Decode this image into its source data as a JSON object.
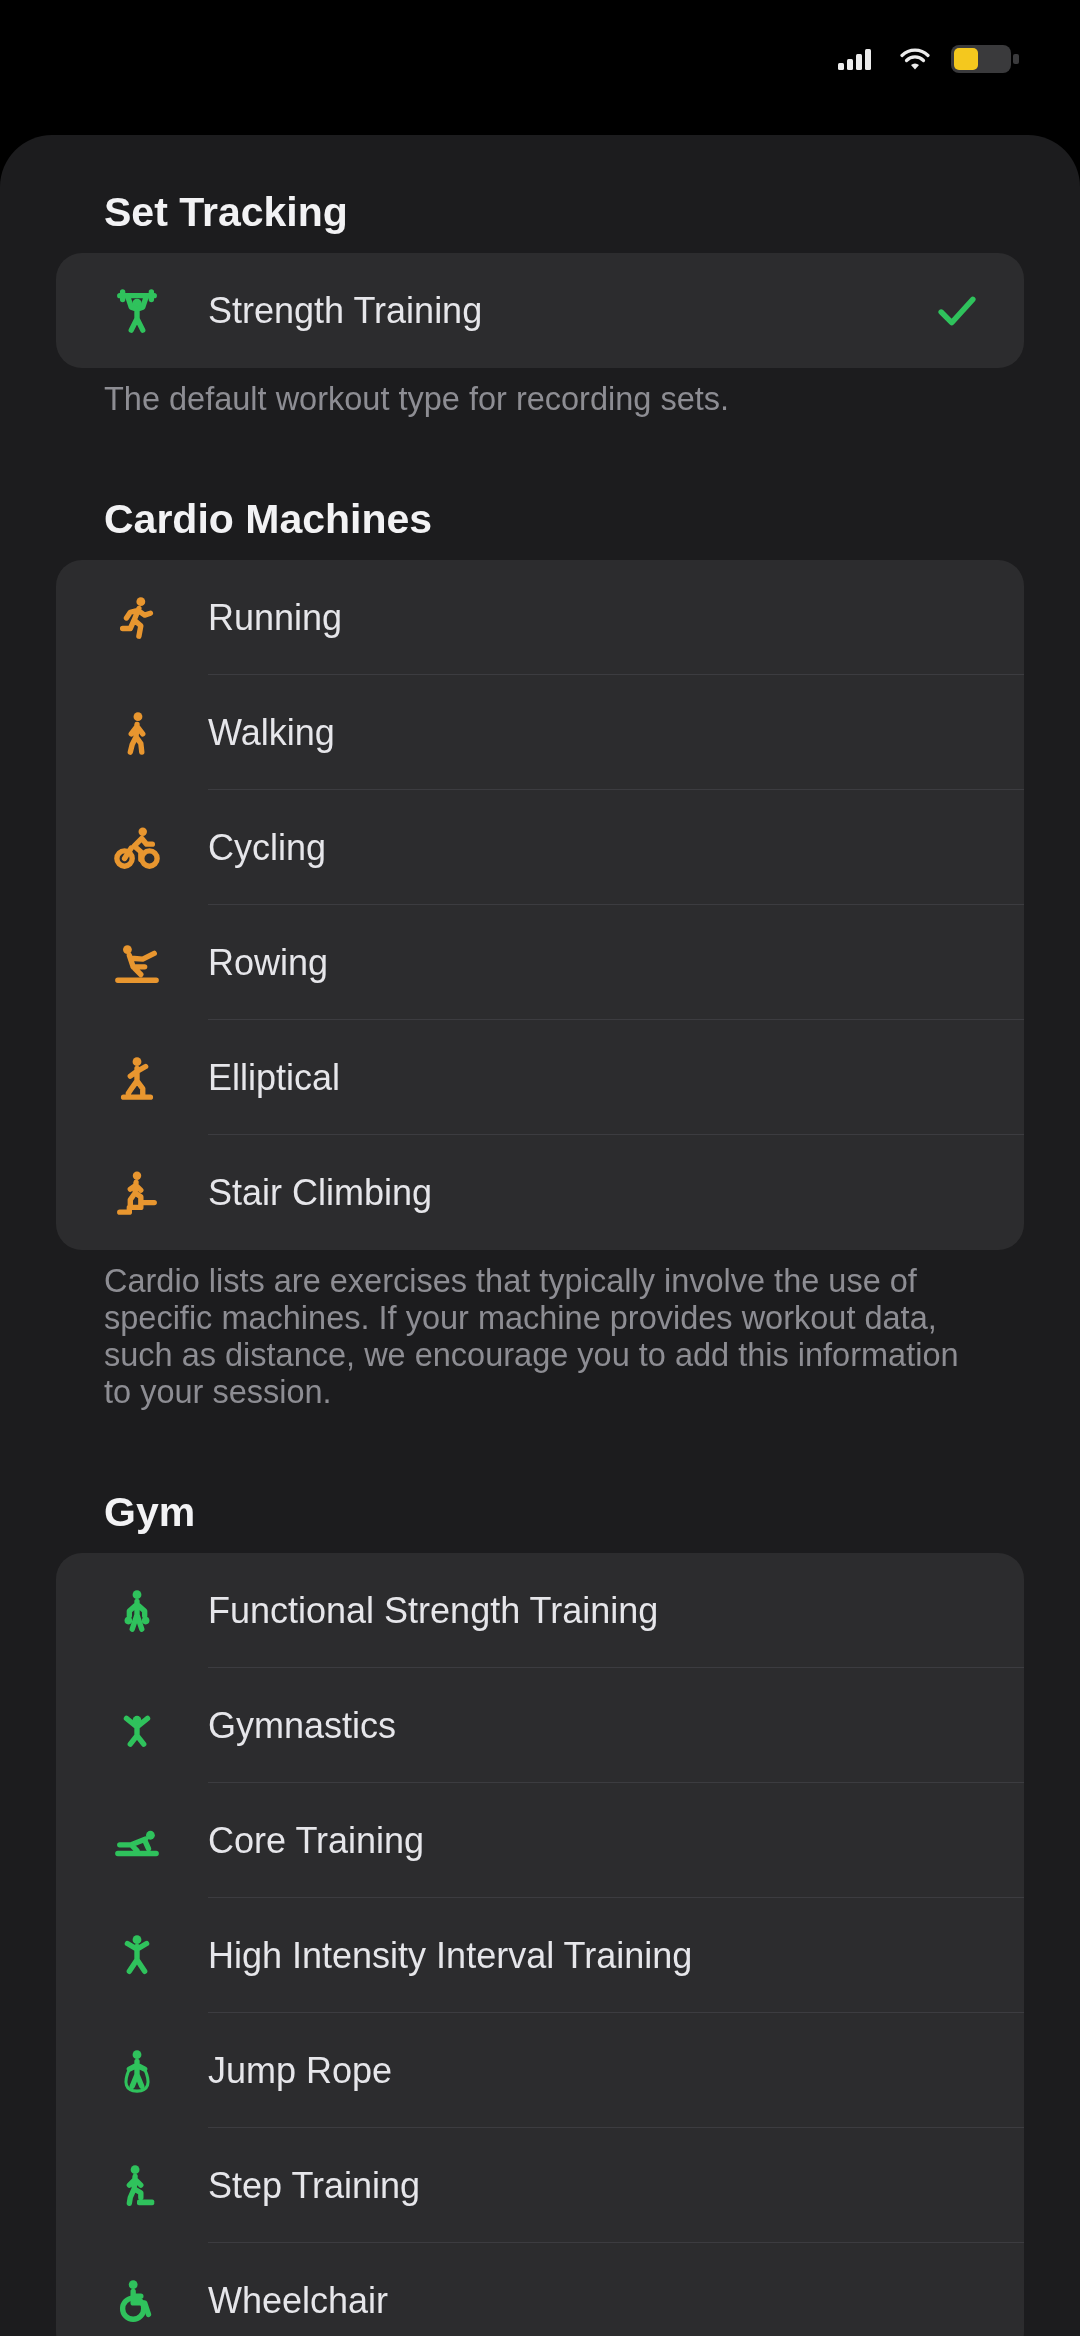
{
  "sections": [
    {
      "header": "Set Tracking",
      "color": "#2fc25c",
      "items": [
        {
          "label": "Strength Training",
          "selected": true
        }
      ],
      "footer": "The default workout type for recording sets."
    },
    {
      "header": "Cardio Machines",
      "color": "#e8962f",
      "items": [
        {
          "label": "Running",
          "selected": false
        },
        {
          "label": "Walking",
          "selected": false
        },
        {
          "label": "Cycling",
          "selected": false
        },
        {
          "label": "Rowing",
          "selected": false
        },
        {
          "label": "Elliptical",
          "selected": false
        },
        {
          "label": "Stair Climbing",
          "selected": false
        }
      ],
      "footer": "Cardio lists are exercises that typically involve the use of specific machines. If your machine provides workout data, such as distance, we encourage you to add this information to your session."
    },
    {
      "header": "Gym",
      "color": "#2fc25c",
      "items": [
        {
          "label": "Functional Strength Training",
          "selected": false
        },
        {
          "label": "Gymnastics",
          "selected": false
        },
        {
          "label": "Core Training",
          "selected": false
        },
        {
          "label": "High Intensity Interval Training",
          "selected": false
        },
        {
          "label": "Jump Rope",
          "selected": false
        },
        {
          "label": "Step Training",
          "selected": false
        },
        {
          "label": "Wheelchair",
          "selected": false
        }
      ]
    }
  ]
}
